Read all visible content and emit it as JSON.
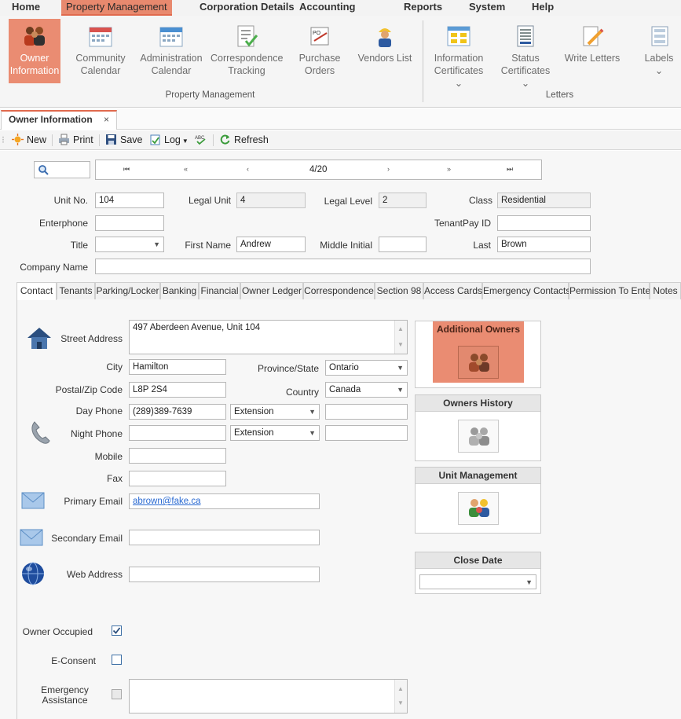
{
  "menu": {
    "items": [
      "Home",
      "Property Management",
      "Corporation Details",
      "Accounting",
      "Reports",
      "System",
      "Help"
    ],
    "active": "Property Management"
  },
  "ribbon": {
    "property_buttons": [
      {
        "line1": "Owner",
        "line2": "Information",
        "icon": "owners-icon"
      },
      {
        "line1": "Community",
        "line2": "Calendar",
        "icon": "calendar-icon"
      },
      {
        "line1": "Administration",
        "line2": "Calendar",
        "icon": "calendar-icon"
      },
      {
        "line1": "Correspondence",
        "line2": "Tracking",
        "icon": "checklist-icon"
      },
      {
        "line1": "Purchase",
        "line2": "Orders",
        "icon": "purchase-order-icon"
      },
      {
        "line1": "Vendors List",
        "line2": "",
        "icon": "worker-icon"
      }
    ],
    "letter_buttons": [
      {
        "line1": "Information",
        "line2": "Certificates ⌄",
        "icon": "certificate-icon"
      },
      {
        "line1": "Status",
        "line2": "Certificates ⌄",
        "icon": "status-certificate-icon"
      },
      {
        "line1": "Write Letters",
        "line2": "",
        "icon": "write-letter-icon"
      },
      {
        "line1": "Labels",
        "line2": "⌄",
        "icon": "labels-icon"
      }
    ],
    "group_property": "Property Management",
    "group_letters": "Letters"
  },
  "doc_tab": {
    "title": "Owner Information",
    "close": "×"
  },
  "toolbar": {
    "new": "New",
    "print": "Print",
    "save": "Save",
    "log": "Log",
    "refresh": "Refresh"
  },
  "navigator": {
    "first": "⏮",
    "prev_page": "«",
    "prev": "‹",
    "position": "4/20",
    "next": "›",
    "next_page": "»",
    "last": "⏭"
  },
  "fields": {
    "unit_no_label": "Unit No.",
    "unit_no": "104",
    "legal_unit_label": "Legal Unit",
    "legal_unit": "4",
    "legal_level_label": "Legal Level",
    "legal_level": "2",
    "class_label": "Class",
    "class": "Residential",
    "enterphone_label": "Enterphone",
    "enterphone": "",
    "tenantpay_label": "TenantPay ID",
    "tenantpay": "",
    "title_label": "Title",
    "title": "",
    "first_name_label": "First Name",
    "first_name": "Andrew",
    "middle_initial_label": "Middle Initial",
    "middle_initial": "",
    "last_label": "Last",
    "last": "Brown",
    "company_label": "Company Name",
    "company": ""
  },
  "tabs": [
    "Contact",
    "Tenants",
    "Parking/Locker",
    "Banking",
    "Financial",
    "Owner Ledger",
    "Correspondence",
    "Section 98",
    "Access Cards",
    "Emergency Contacts",
    "Permission To Enter",
    "Notes"
  ],
  "contact": {
    "street_label": "Street Address",
    "street": "497 Aberdeen Avenue, Unit 104",
    "city_label": "City",
    "city": "Hamilton",
    "province_label": "Province/State",
    "province": "Ontario",
    "postal_label": "Postal/Zip Code",
    "postal": "L8P 2S4",
    "country_label": "Country",
    "country": "Canada",
    "day_phone_label": "Day Phone",
    "day_phone": "(289)389-7639",
    "day_ext": "Extension",
    "night_phone_label": "Night Phone",
    "night_phone": "",
    "night_ext": "Extension",
    "mobile_label": "Mobile",
    "mobile": "",
    "fax_label": "Fax",
    "fax": "",
    "primary_email_label": "Primary Email",
    "primary_email": "abrown@fake.ca",
    "secondary_email_label": "Secondary Email",
    "secondary_email": "",
    "web_label": "Web Address",
    "web": "",
    "owner_occupied_label": "Owner Occupied",
    "owner_occupied": true,
    "econsent_label": "E-Consent",
    "econsent": false,
    "emergency_label_1": "Emergency",
    "emergency_label_2": "Assistance"
  },
  "side": {
    "additional_owners": "Additional Owners",
    "owners_history": "Owners History",
    "unit_management": "Unit Management",
    "close_date": "Close Date"
  },
  "colors": {
    "accent": "#e8896e",
    "accent_dark": "#e06a4e",
    "link": "#2a6ad2"
  }
}
